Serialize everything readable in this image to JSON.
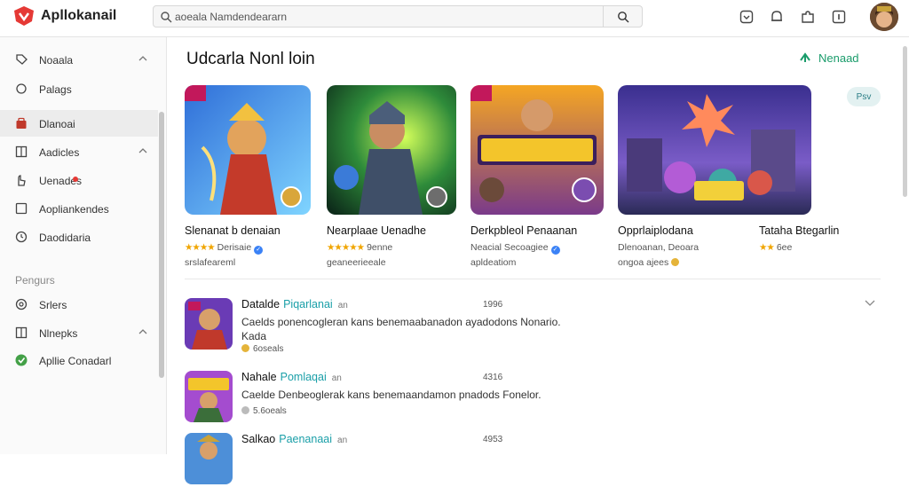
{
  "app": {
    "title": "Apllokanail"
  },
  "search": {
    "value": "aoeala Namdendeararn",
    "placeholder": ""
  },
  "sidebar": {
    "items": [
      {
        "label": "Noaala",
        "icon": "tag-icon",
        "chevron": true,
        "active": false
      },
      {
        "label": "Palags",
        "icon": "bell-icon",
        "chevron": false,
        "active": false
      },
      {
        "label": "Dlanoai",
        "icon": "store-icon",
        "chevron": false,
        "active": true
      },
      {
        "label": "Aadicles",
        "icon": "grid-icon",
        "chevron": true,
        "active": false
      },
      {
        "label": "Uenades",
        "icon": "hand-icon",
        "chevron": false,
        "active": false
      },
      {
        "label": "Aopliankendes",
        "icon": "square-icon",
        "chevron": false,
        "active": false
      },
      {
        "label": "Daodidaria",
        "icon": "clock-icon",
        "chevron": false,
        "active": false
      }
    ],
    "section_label": "Pengurs",
    "section_items": [
      {
        "label": "Srlers",
        "icon": "target-icon",
        "chevron": false
      },
      {
        "label": "Nlnepks",
        "icon": "grid-icon",
        "chevron": true
      },
      {
        "label": "Apllie Conadarl",
        "icon": "star-badge-icon",
        "chevron": false
      }
    ]
  },
  "main": {
    "section_title": "Udcarla Nonl loin",
    "see_more": "Nenaad",
    "pill": "Psv",
    "cards": [
      {
        "name": "Slenanat b denaian",
        "stars": "★★★★",
        "rating_text": "Derisaie",
        "badge": "grey",
        "sub": "srslafeareml"
      },
      {
        "name": "Nearplaae Uenadhe",
        "stars": "★★★★★",
        "rating_text": "9enne",
        "badge": "",
        "sub": "geaneerieeale"
      },
      {
        "name": "Derkpbleol Penaanan",
        "stars": "",
        "rating_text": "Neacial Secoagiee",
        "badge": "blue",
        "sub": "apldeatiom"
      },
      {
        "name": "Opprlaiplodana",
        "stars": "",
        "rating_text": "Dlenoanan, Deoara",
        "badge": "",
        "sub": "ongoa ajees"
      },
      {
        "name": "Tataha Btegarlin",
        "stars": "★★",
        "rating_text": "6ee",
        "badge": "",
        "sub": ""
      }
    ],
    "list": [
      {
        "title": "Datalde",
        "tag": "Piqarlanai",
        "small": "an",
        "num": "1996",
        "desc": "Caelds  ponencogleran kans benemaabanadon ayadodons Nonario. Kada",
        "meta": "6oseals"
      },
      {
        "title": "Nahale",
        "tag": "Pomlaqai",
        "small": "an",
        "num": "4316",
        "desc": "Caelde  Denbeoglerak kans benemaandamon pnadods Fonelor.",
        "meta": "5.6oeals"
      },
      {
        "title": "Salkao",
        "tag": "Paenanaai",
        "small": "an",
        "num": "4953",
        "desc": "",
        "meta": ""
      }
    ]
  },
  "colors": {
    "accent": "#1a9c6b",
    "logo": "#e53935",
    "teal": "#1a9fa8",
    "star": "#f0a500"
  }
}
